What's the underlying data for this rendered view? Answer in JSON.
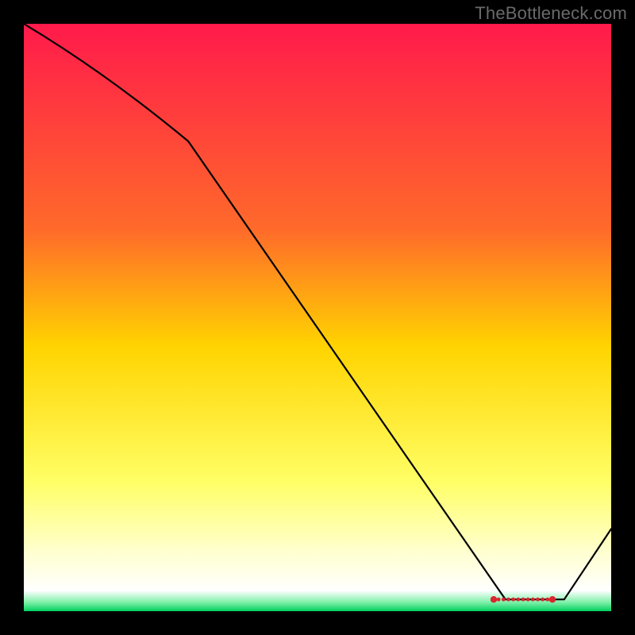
{
  "attribution": "TheBottleneck.com",
  "chart_data": {
    "type": "line",
    "title": "",
    "xlabel": "",
    "ylabel": "",
    "xlim": [
      0,
      100
    ],
    "ylim": [
      0,
      100
    ],
    "x": [
      0,
      28,
      82,
      92,
      100
    ],
    "values": [
      100,
      80,
      2,
      2,
      14
    ],
    "markers": {
      "x_start": 80,
      "x_end": 90,
      "y": 2
    },
    "background_gradient": {
      "stops": [
        {
          "offset": 0.0,
          "color": "#ff1a4b"
        },
        {
          "offset": 0.35,
          "color": "#ff6a2a"
        },
        {
          "offset": 0.55,
          "color": "#ffd400"
        },
        {
          "offset": 0.78,
          "color": "#ffff66"
        },
        {
          "offset": 0.9,
          "color": "#ffffd0"
        },
        {
          "offset": 0.965,
          "color": "#ffffff"
        },
        {
          "offset": 0.985,
          "color": "#7ef0a8"
        },
        {
          "offset": 1.0,
          "color": "#00d060"
        }
      ]
    }
  }
}
